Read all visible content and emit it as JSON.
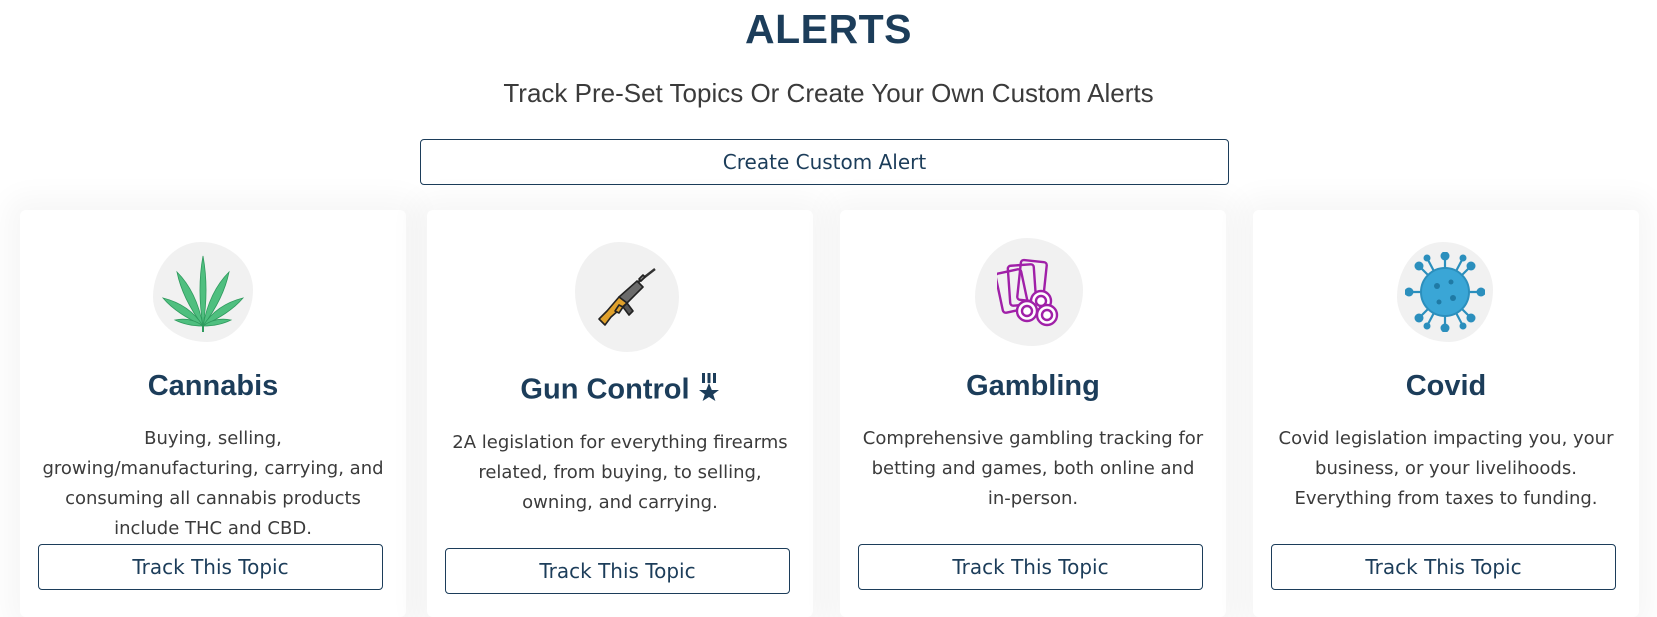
{
  "header": {
    "title": "ALERTS",
    "subtitle": "Track Pre-Set Topics Or Create Your Own Custom Alerts",
    "create_button": "Create Custom Alert"
  },
  "cards": [
    {
      "title": "Cannabis",
      "icon": "cannabis-leaf-icon",
      "description": "Buying, selling, growing/manufacturing, carrying, and consuming all cannabis products include THC and CBD.",
      "button": "Track This Topic"
    },
    {
      "title": "Gun Control",
      "icon": "rifle-icon",
      "badge_icon": "medal-star-icon",
      "description": "2A legislation for everything firearms related, from buying, to selling, owning, and carrying.",
      "button": "Track This Topic"
    },
    {
      "title": "Gambling",
      "icon": "cards-chips-icon",
      "description": "Comprehensive gambling tracking for betting and games, both online and in-person.",
      "button": "Track This Topic"
    },
    {
      "title": "Covid",
      "icon": "virus-icon",
      "description": "Covid legislation impacting you, your business, or your livelihoods. Everything from taxes to funding.",
      "button": "Track This Topic"
    }
  ],
  "colors": {
    "primary": "#1c3d5a",
    "text": "#3b3b3b",
    "cannabis": "#4fbf7f",
    "gambling": "#a020a8",
    "covid": "#3aa6d6"
  }
}
